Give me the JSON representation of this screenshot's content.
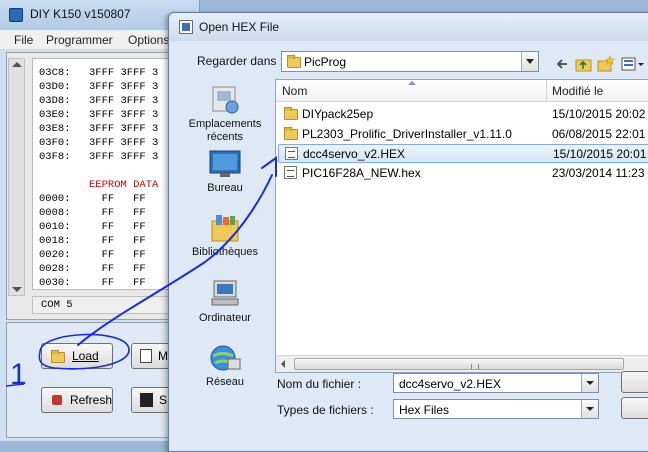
{
  "bg_window": {
    "title": "DIY K150 v150807",
    "menu": [
      "File",
      "Programmer",
      "Options"
    ],
    "hex_rows": [
      {
        "addr": "03C8:",
        "vals": "3FFF 3FFF 3"
      },
      {
        "addr": "03D0:",
        "vals": "3FFF 3FFF 3"
      },
      {
        "addr": "03D8:",
        "vals": "3FFF 3FFF 3"
      },
      {
        "addr": "03E0:",
        "vals": "3FFF 3FFF 3"
      },
      {
        "addr": "03E8:",
        "vals": "3FFF 3FFF 3"
      },
      {
        "addr": "03F0:",
        "vals": "3FFF 3FFF 3"
      },
      {
        "addr": "03F8:",
        "vals": "3FFF 3FFF 3"
      }
    ],
    "eeprom_label": "EEPROM DATA",
    "eeprom_rows": [
      {
        "addr": "0000:",
        "vals": "  FF   FF"
      },
      {
        "addr": "0008:",
        "vals": "  FF   FF"
      },
      {
        "addr": "0010:",
        "vals": "  FF   FF"
      },
      {
        "addr": "0018:",
        "vals": "  FF   FF"
      },
      {
        "addr": "0020:",
        "vals": "  FF   FF"
      },
      {
        "addr": "0028:",
        "vals": "  FF   FF"
      },
      {
        "addr": "0030:",
        "vals": "  FF   FF"
      }
    ],
    "status": "COM 5",
    "buttons": {
      "load": "Load",
      "refresh": "Refresh",
      "m_partial": "M",
      "s_partial": "S"
    }
  },
  "dialog": {
    "title": "Open HEX File",
    "look_in_label": "Regarder dans :",
    "look_in_value": "PicProg",
    "places": [
      {
        "label": "Emplacements récents",
        "icon": "recent-places-icon"
      },
      {
        "label": "Bureau",
        "icon": "desktop-icon"
      },
      {
        "label": "Bibliothèques",
        "icon": "libraries-icon"
      },
      {
        "label": "Ordinateur",
        "icon": "computer-icon"
      },
      {
        "label": "Réseau",
        "icon": "network-icon"
      }
    ],
    "columns": {
      "name": "Nom",
      "modified": "Modifié le"
    },
    "files": [
      {
        "name": "DIYpack25ep",
        "date": "15/10/2015 20:02",
        "type": "folder"
      },
      {
        "name": "PL2303_Prolific_DriverInstaller_v1.11.0",
        "date": "06/08/2015 22:01",
        "type": "folder"
      },
      {
        "name": "dcc4servo_v2.HEX",
        "date": "15/10/2015 20:01",
        "type": "hex",
        "selected": true
      },
      {
        "name": "PIC16F28A_NEW.hex",
        "date": "23/03/2014 11:23",
        "type": "hex"
      }
    ],
    "filename_label": "Nom du fichier :",
    "filename_value": "dcc4servo_v2.HEX",
    "filetype_label": "Types de fichiers :",
    "filetype_value": "Hex Files"
  },
  "annotation": {
    "number": "1",
    "color": "#1a2fd0"
  }
}
